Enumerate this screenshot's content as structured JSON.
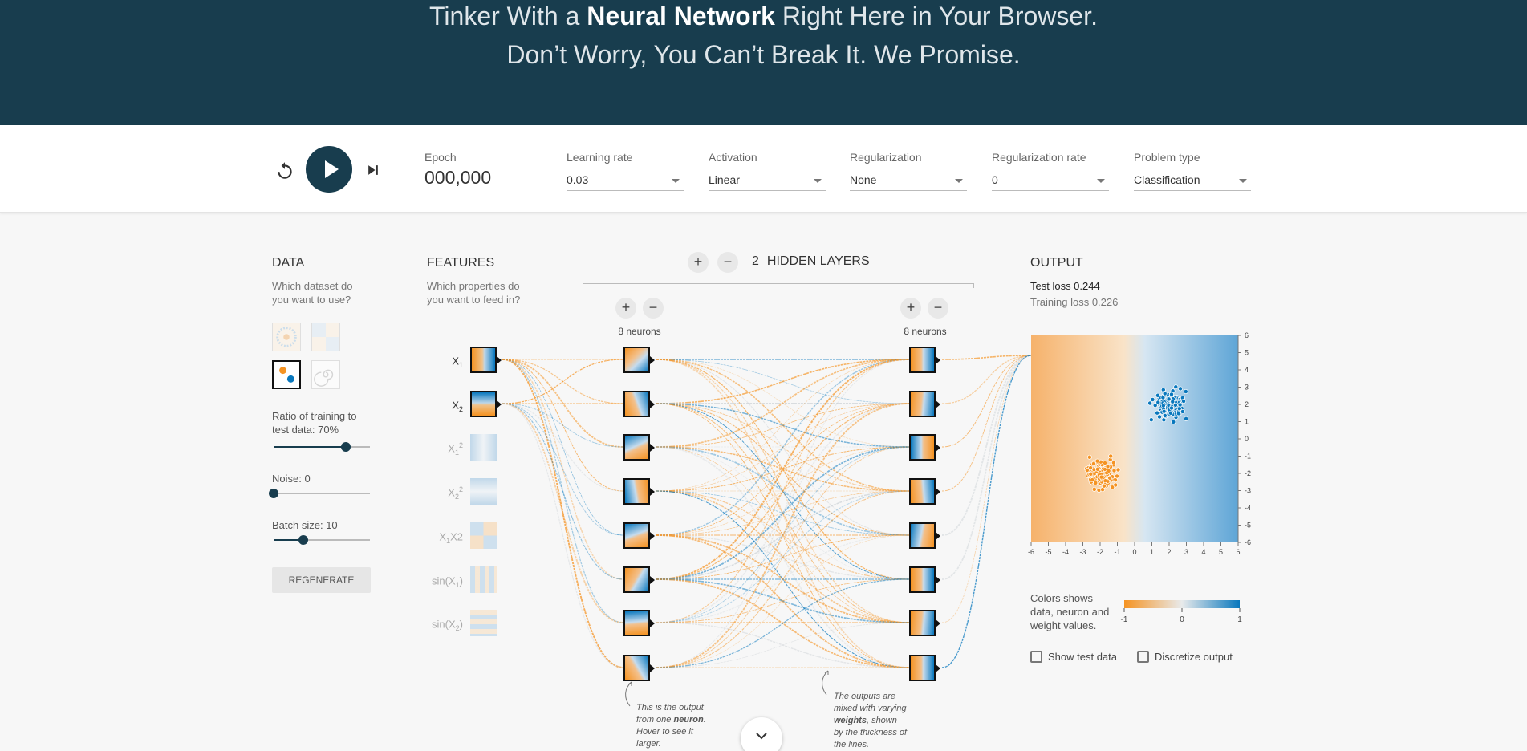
{
  "hero": {
    "line1_pre": "Tinker With a ",
    "line1_bold": "Neural Network",
    "line1_post": " Right Here in Your Browser.",
    "line2": "Don’t Worry, You Can’t Break It. We Promise."
  },
  "controls": {
    "epoch_label": "Epoch",
    "epoch_value": "000,000",
    "learning_rate_label": "Learning rate",
    "learning_rate_value": "0.03",
    "activation_label": "Activation",
    "activation_value": "Linear",
    "regularization_label": "Regularization",
    "regularization_value": "None",
    "reg_rate_label": "Regularization rate",
    "reg_rate_value": "0",
    "problem_type_label": "Problem type",
    "problem_type_value": "Classification"
  },
  "data": {
    "title": "DATA",
    "subtitle_1": "Which dataset do",
    "subtitle_2": "you want to use?",
    "ratio_label_1": "Ratio of training to",
    "ratio_label_2": "test data:  70%",
    "ratio_value": 0.7,
    "noise_label": "Noise:  0",
    "noise_value": 0,
    "batch_label": "Batch size:  10",
    "batch_value": 0.31,
    "regenerate": "REGENERATE"
  },
  "features": {
    "title": "FEATURES",
    "subtitle_1": "Which properties do",
    "subtitle_2": "you want to feed in?",
    "items": [
      {
        "base": "X",
        "sub": "1",
        "sup": "",
        "tail": ""
      },
      {
        "base": "X",
        "sub": "2",
        "sup": "",
        "tail": ""
      },
      {
        "base": "X",
        "sub": "1",
        "sup": "2",
        "tail": ""
      },
      {
        "base": "X",
        "sub": "2",
        "sup": "2",
        "tail": ""
      },
      {
        "base": "X",
        "sub": "1",
        "sup": "",
        "tail": "X2"
      },
      {
        "base": "sin(X",
        "sub": "1",
        "sup": "",
        "tail": ")"
      },
      {
        "base": "sin(X",
        "sub": "2",
        "sup": "",
        "tail": ")"
      }
    ]
  },
  "layers": {
    "count": "2",
    "label": "HIDDEN LAYERS",
    "plus": "+",
    "minus": "−",
    "layer1_neurons": "8 neurons",
    "layer2_neurons": "8 neurons",
    "note1": [
      "This is the output",
      "from one neuron.",
      "Hover to see it",
      "larger."
    ],
    "note2": [
      "The outputs are",
      "mixed with varying",
      "weights, shown",
      "by the thickness of",
      "the lines."
    ]
  },
  "output": {
    "title": "OUTPUT",
    "test_loss": "Test loss 0.244",
    "training_loss": "Training loss 0.226",
    "x_ticks": [
      "-6",
      "-5",
      "-4",
      "-3",
      "-2",
      "-1",
      "0",
      "1",
      "2",
      "3",
      "4",
      "5",
      "6"
    ],
    "y_ticks": [
      "6",
      "5",
      "4",
      "3",
      "2",
      "1",
      "0",
      "-1",
      "-2",
      "-3",
      "-4",
      "-5",
      "-6"
    ],
    "legend_text": "Colors shows data, neuron and weight values.",
    "legend_ticks": [
      "-1",
      "0",
      "1"
    ],
    "show_test_data": "Show test data",
    "discretize_output": "Discretize output"
  },
  "colors": {
    "orange": "#f59322",
    "blue": "#0877bd",
    "dark": "#183d4e"
  },
  "icons": {
    "reset": "reset-icon",
    "play": "play-icon",
    "step": "step-forward-icon",
    "down": "chevron-down-icon"
  }
}
